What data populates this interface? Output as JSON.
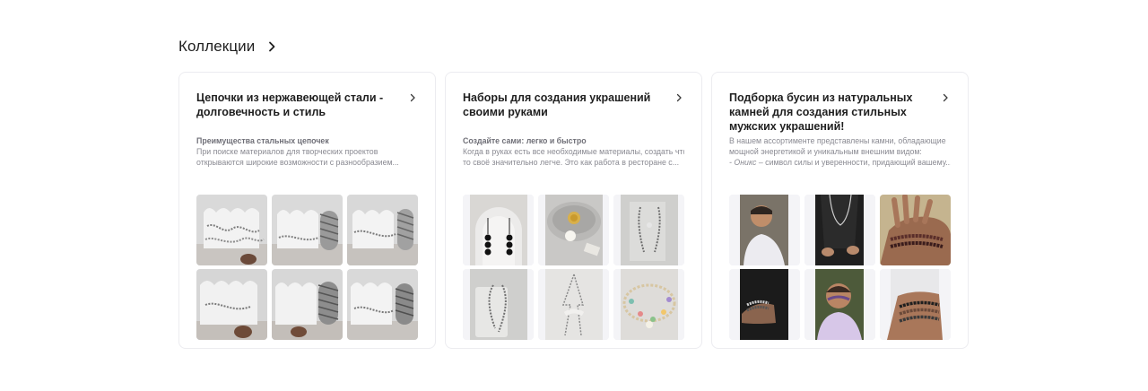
{
  "section": {
    "title": "Коллекции"
  },
  "cards": [
    {
      "title": "Цепочки из нержавеющей стали - долговечность и стиль",
      "desc_heading": "Преимущества стальных цепочек",
      "desc_line1": "При поиске материалов для творческих проектов",
      "desc_line2": "открываются широкие возможности с разнообразием..."
    },
    {
      "title": "Наборы для создания украшений своими руками",
      "desc_heading": "Создайте сами: легко и быстро",
      "desc_line1": "Когда в руках есть все необходимые материалы, создать что-",
      "desc_line2": "то своё значительно легче. Это как работа в ресторане с..."
    },
    {
      "title": "Подборка бусин из натуральных камней для создания стильных мужских украшений!",
      "desc_line1": "В нашем ассортименте представлены камни, обладающие",
      "desc_line2": "мощной энергетикой и уникальным внешним видом:",
      "desc_line3_italic": "- Оникс",
      "desc_line3_rest": " – символ силы и уверенности, придающий вашему..."
    }
  ],
  "icons": {
    "section_chevron": "chevron-right-icon",
    "card_chevron": "chevron-right-icon"
  }
}
